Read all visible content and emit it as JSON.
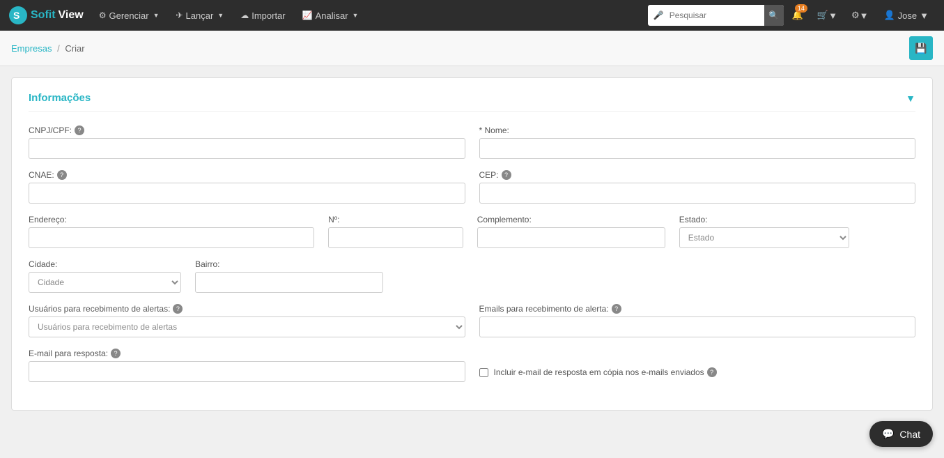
{
  "brand": {
    "sofit": "Sofit",
    "view": "View"
  },
  "navbar": {
    "items": [
      {
        "id": "gerenciar",
        "label": "Gerenciar",
        "icon": "⚙",
        "hasDropdown": true
      },
      {
        "id": "lancar",
        "label": "Lançar",
        "icon": "✈",
        "hasDropdown": true
      },
      {
        "id": "importar",
        "label": "Importar",
        "icon": "☁",
        "hasDropdown": false
      },
      {
        "id": "analisar",
        "label": "Analisar",
        "icon": "📈",
        "hasDropdown": true
      }
    ],
    "search": {
      "placeholder": "Pesquisar"
    },
    "notifications_badge": "14",
    "user": "Jose"
  },
  "breadcrumb": {
    "parent_label": "Empresas",
    "separator": "/",
    "current": "Criar"
  },
  "form": {
    "section_title": "Informações",
    "fields": {
      "cnpj_label": "CNPJ/CPF:",
      "nome_label": "* Nome:",
      "cnae_label": "CNAE:",
      "cep_label": "CEP:",
      "endereco_label": "Endereço:",
      "numero_label": "Nº:",
      "complemento_label": "Complemento:",
      "estado_label": "Estado:",
      "estado_placeholder": "Estado",
      "cidade_label": "Cidade:",
      "cidade_placeholder": "Cidade",
      "bairro_label": "Bairro:",
      "usuarios_label": "Usuários para recebimento de alertas:",
      "usuarios_placeholder": "Usuários para recebimento de alertas",
      "emails_label": "Emails para recebimento de alerta:",
      "email_resposta_label": "E-mail para resposta:",
      "incluir_email_label": "Incluir e-mail de resposta em cópia nos e-mails enviados"
    }
  },
  "chat": {
    "label": "Chat"
  }
}
